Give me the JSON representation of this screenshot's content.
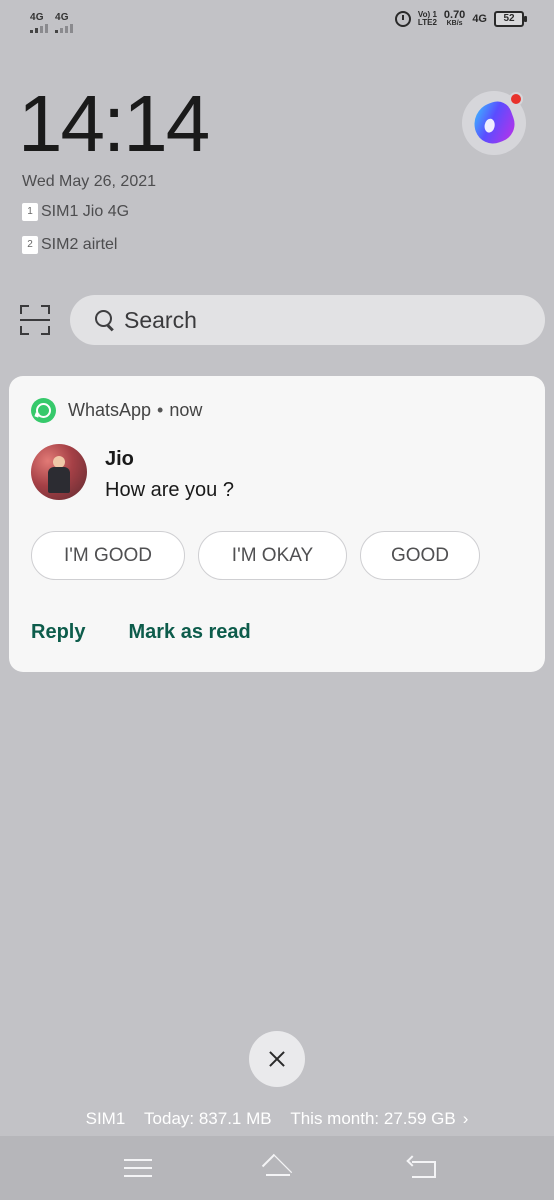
{
  "status_bar": {
    "sim1_network": "4G",
    "sim2_network": "4G",
    "volte_top": "Vo) 1",
    "volte_bottom": "LTE2",
    "speed_value": "0.70",
    "speed_unit": "KB/s",
    "network_type": "4G",
    "battery": "52",
    "icons": [
      "alarm-icon",
      "battery-icon"
    ]
  },
  "lockscreen": {
    "time": "14:14",
    "date": "Wed May 26, 2021",
    "sims": [
      {
        "slot": "1",
        "label": "SIM1 Jio 4G"
      },
      {
        "slot": "2",
        "label": "SIM2 airtel"
      }
    ]
  },
  "search": {
    "placeholder": "Search"
  },
  "notification": {
    "app": "WhatsApp",
    "separator": "•",
    "time": "now",
    "sender": "Jio",
    "message": "How are you ?",
    "quick_replies": [
      "I'M GOOD",
      "I'M OKAY",
      "GOOD"
    ],
    "actions": [
      "Reply",
      "Mark as read"
    ],
    "accent_color": "#0d5c4b",
    "app_color": "#36c96b"
  },
  "data_usage": {
    "sim": "SIM1",
    "today": "Today: 837.1 MB",
    "month": "This month: 27.59 GB",
    "chevron": "›"
  }
}
